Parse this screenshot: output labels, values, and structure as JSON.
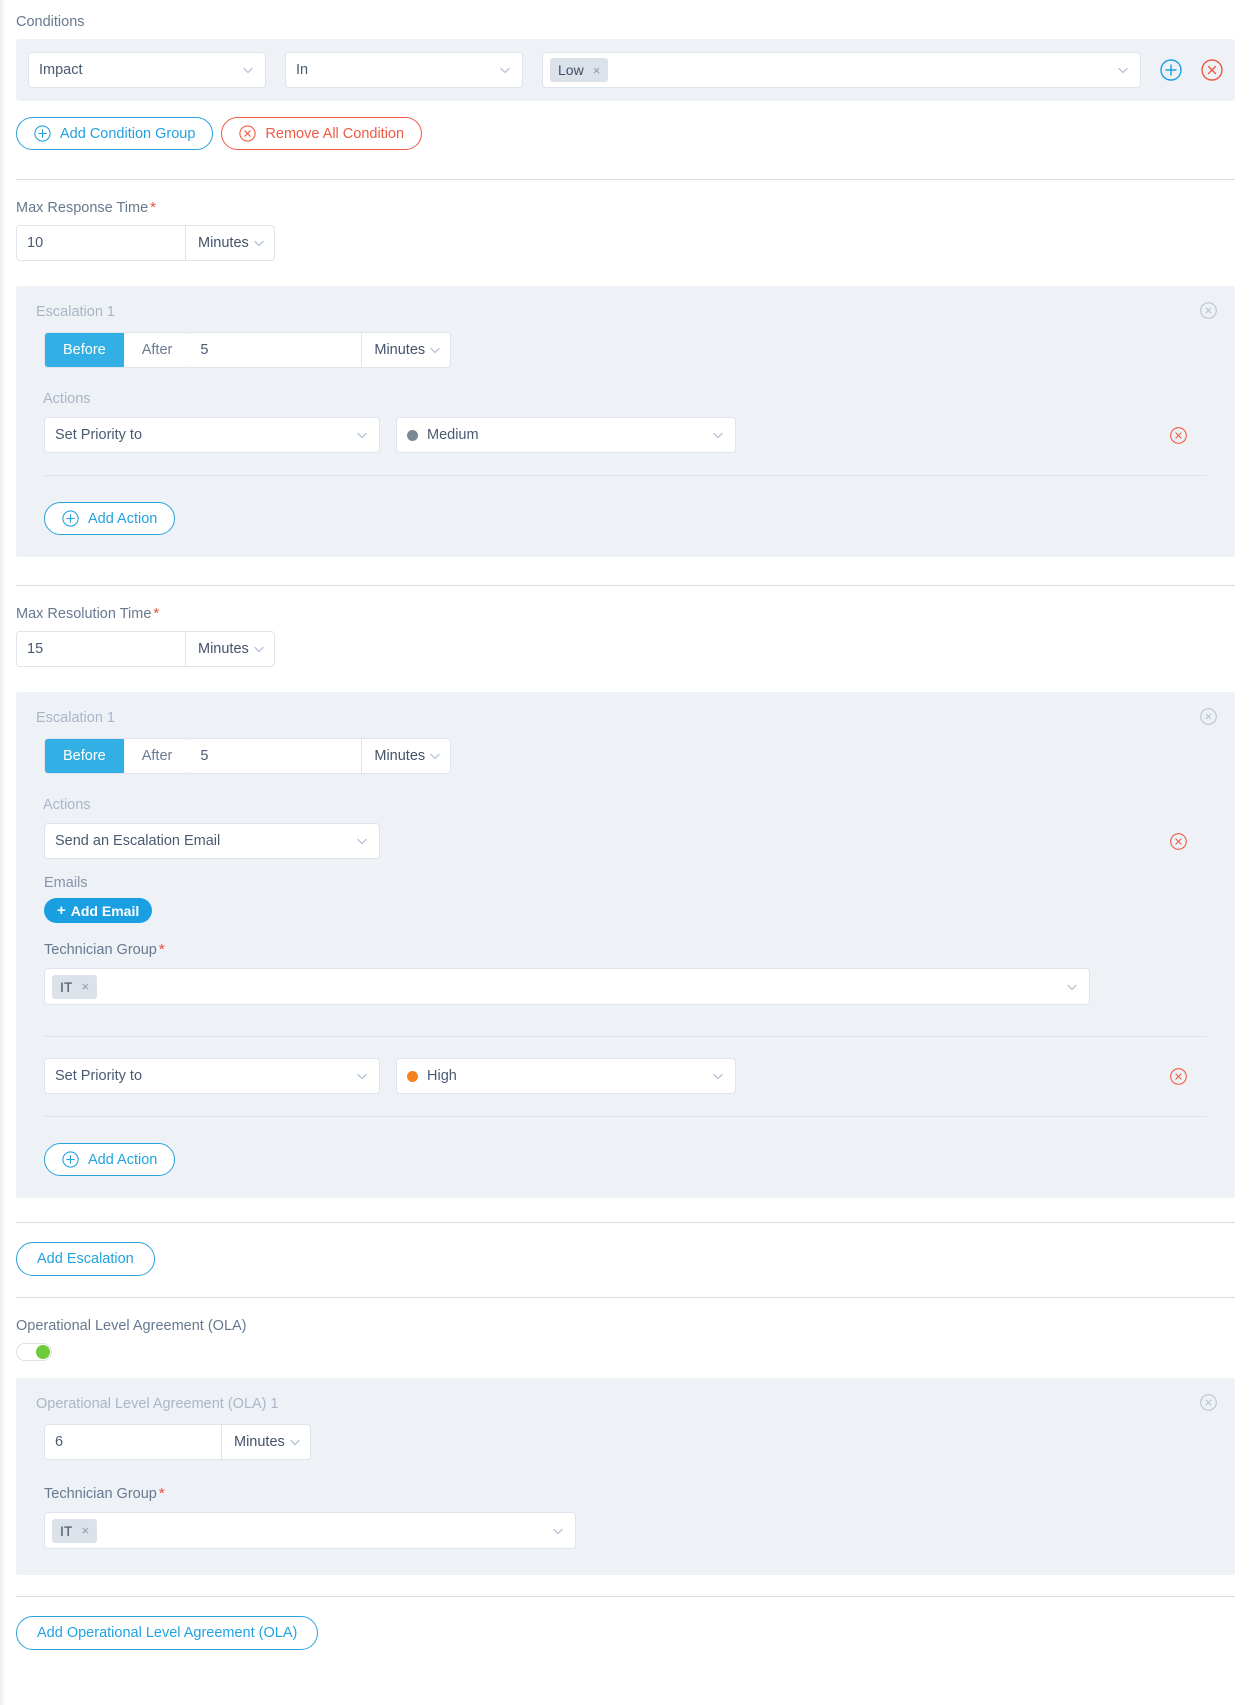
{
  "conditions": {
    "label": "Conditions",
    "row": {
      "attribute": "Impact",
      "operator": "In",
      "value_chip": "Low",
      "chip_remove": "×"
    },
    "add_row_icon": "plus-circle-icon",
    "remove_row_icon": "remove-circle-icon",
    "add_group_label": "Add Condition Group",
    "remove_all_label": "Remove All Condition"
  },
  "max_response_time": {
    "label": "Max Response Time",
    "required_mark": "*",
    "value": "10",
    "unit": "Minutes",
    "escalation": {
      "title": "Escalation 1",
      "before_label": "Before",
      "after_label": "After",
      "active": "Before",
      "offset_value": "5",
      "offset_unit": "Minutes",
      "actions_label": "Actions",
      "actions": [
        {
          "type": "Set Priority to",
          "value": "Medium",
          "value_color": "#7b8896"
        }
      ],
      "add_action_label": "Add Action"
    }
  },
  "max_resolution_time": {
    "label": "Max Resolution Time",
    "required_mark": "*",
    "value": "15",
    "unit": "Minutes",
    "escalation": {
      "title": "Escalation 1",
      "before_label": "Before",
      "after_label": "After",
      "active": "Before",
      "offset_value": "5",
      "offset_unit": "Minutes",
      "actions_label": "Actions",
      "email_action": {
        "type": "Send an Escalation Email",
        "emails_label": "Emails",
        "add_email_label": "Add Email",
        "add_email_plus": "+",
        "technician_group_label": "Technician Group",
        "technician_group_required": "*",
        "technician_group_chip": "IT",
        "chip_remove": "×"
      },
      "priority_action": {
        "type": "Set Priority to",
        "value": "High",
        "value_color": "#f5821f"
      },
      "add_action_label": "Add Action"
    },
    "add_escalation_label": "Add Escalation"
  },
  "ola": {
    "label": "Operational Level Agreement (OLA)",
    "enabled": true,
    "item": {
      "title": "Operational Level Agreement (OLA) 1",
      "value": "6",
      "unit": "Minutes",
      "technician_group_label": "Technician Group",
      "technician_group_required": "*",
      "technician_group_chip": "IT",
      "chip_remove": "×"
    },
    "add_label": "Add Operational Level Agreement (OLA)"
  }
}
